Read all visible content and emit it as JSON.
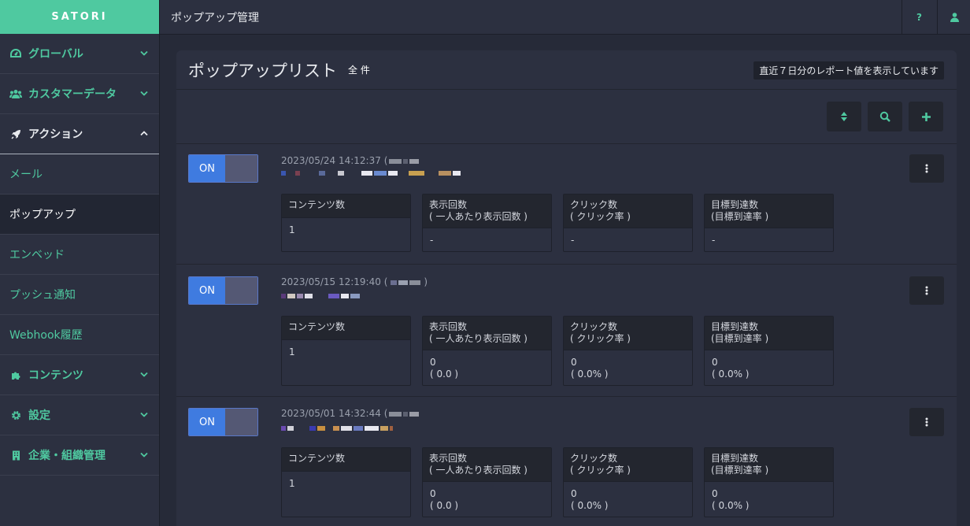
{
  "brand": "SATORI",
  "sidebar": {
    "groups": [
      {
        "label": "グローバル",
        "icon": "dashboard-icon"
      },
      {
        "label": "カスタマーデータ",
        "icon": "users-icon"
      },
      {
        "label": "アクション",
        "icon": "rocket-icon"
      },
      {
        "label": "コンテンツ",
        "icon": "puzzle-icon"
      },
      {
        "label": "設定",
        "icon": "gear-icon"
      },
      {
        "label": "企業・組織管理",
        "icon": "building-icon"
      }
    ],
    "action_items": [
      "メール",
      "ポップアップ",
      "エンベッド",
      "プッシュ通知",
      "Webhook履歴"
    ]
  },
  "topbar": {
    "title": "ポップアップ管理",
    "help": "?",
    "user_icon": "user-icon"
  },
  "panel": {
    "title": "ポップアップリスト",
    "tag": "全 件",
    "note": "直近７日分のレポート値を表示しています"
  },
  "toolbar": {
    "sort_icon": "sort-icon",
    "search_icon": "search-icon",
    "add_icon": "plus-icon"
  },
  "stat_headers": {
    "contents": "コンテンツ数",
    "views_l1": "表示回数",
    "views_l2": "( 一人あたり表示回数 )",
    "clicks_l1": "クリック数",
    "clicks_l2": "( クリック率 )",
    "goals_l1": "目標到達数",
    "goals_l2": "(目標到達率 )"
  },
  "popups": [
    {
      "toggle": "ON",
      "date": "2023/05/24 14:12:37 (",
      "close_paren": "",
      "contents": "1",
      "views": "-",
      "views_sub": "",
      "clicks": "-",
      "clicks_sub": "",
      "goals": "-",
      "goals_sub": ""
    },
    {
      "toggle": "ON",
      "date": "2023/05/15 12:19:40 (",
      "close_paren": ")",
      "contents": "1",
      "views": "0",
      "views_sub": "( 0.0 )",
      "clicks": "0",
      "clicks_sub": "( 0.0% )",
      "goals": "0",
      "goals_sub": "( 0.0% )"
    },
    {
      "toggle": "ON",
      "date": "2023/05/01 14:32:44 (",
      "close_paren": "",
      "contents": "1",
      "views": "0",
      "views_sub": "( 0.0 )",
      "clicks": "0",
      "clicks_sub": "( 0.0% )",
      "goals": "0",
      "goals_sub": "( 0.0% )"
    }
  ]
}
